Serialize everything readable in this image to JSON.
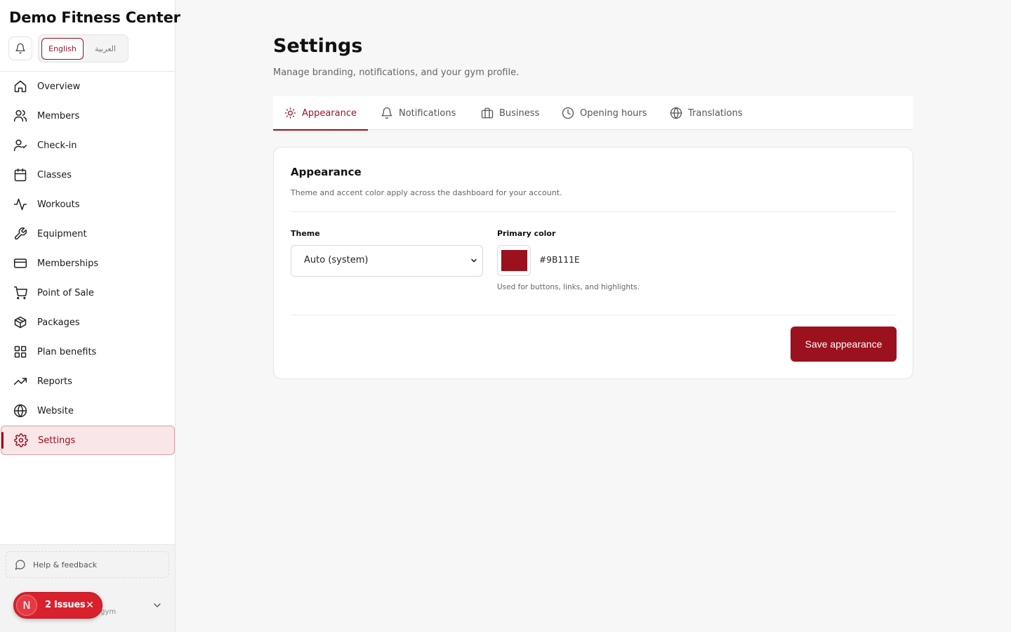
{
  "app": {
    "brand": "Demo Fitness Center"
  },
  "header": {
    "lang_english": "English",
    "lang_arabic": "العربية"
  },
  "sidebar": {
    "items": [
      {
        "label": "Overview",
        "icon": "home-icon"
      },
      {
        "label": "Members",
        "icon": "users-icon"
      },
      {
        "label": "Check-in",
        "icon": "user-check-icon"
      },
      {
        "label": "Classes",
        "icon": "calendar-icon"
      },
      {
        "label": "Workouts",
        "icon": "activity-icon"
      },
      {
        "label": "Equipment",
        "icon": "wrench-icon"
      },
      {
        "label": "Memberships",
        "icon": "credit-card-icon"
      },
      {
        "label": "Point of Sale",
        "icon": "cart-icon"
      },
      {
        "label": "Packages",
        "icon": "package-icon"
      },
      {
        "label": "Plan benefits",
        "icon": "grid-icon"
      },
      {
        "label": "Reports",
        "icon": "trending-up-icon"
      },
      {
        "label": "Website",
        "icon": "globe-icon"
      },
      {
        "label": "Settings",
        "icon": "gear-icon",
        "active": true
      }
    ],
    "help": "Help & feedback",
    "user_domain": ".gym"
  },
  "issues_badge": {
    "avatar_letter": "N",
    "text": "2 Issues"
  },
  "main": {
    "title": "Settings",
    "subtitle": "Manage branding, notifications, and your gym profile.",
    "tabs": [
      {
        "label": "Appearance",
        "icon": "sun-icon",
        "active": true
      },
      {
        "label": "Notifications",
        "icon": "bell-icon"
      },
      {
        "label": "Business",
        "icon": "briefcase-icon"
      },
      {
        "label": "Opening hours",
        "icon": "clock-icon"
      },
      {
        "label": "Translations",
        "icon": "globe-icon"
      }
    ],
    "card": {
      "title": "Appearance",
      "description": "Theme and accent color apply across the dashboard for your account.",
      "theme_label": "Theme",
      "theme_value": "Auto (system)",
      "primary_color_label": "Primary color",
      "primary_color_value": "#9B111E",
      "primary_color_hint": "Used for buttons, links, and highlights.",
      "save_label": "Save appearance"
    }
  },
  "colors": {
    "accent": "#9B111E",
    "active_bg": "#F8E6E8",
    "issues_red": "#D8212C"
  }
}
